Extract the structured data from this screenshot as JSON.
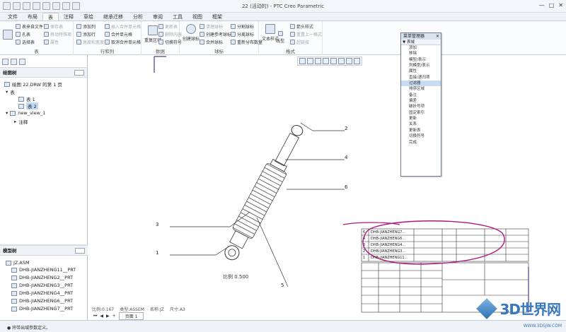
{
  "window": {
    "title": "22 (活动的) - PTC Creo Parametric"
  },
  "tabs": [
    "文件",
    "布局",
    "表",
    "注释",
    "草绘",
    "继承迁移",
    "分析",
    "审阅",
    "工具",
    "视图",
    "框架"
  ],
  "ribbon": {
    "table_group": {
      "items": [
        "表来自文件",
        "孔表",
        "选择表",
        "保存表",
        "移动特殊项",
        "属性"
      ],
      "label": "表"
    },
    "rowcol_group": {
      "items": [
        "添加列",
        "添加行",
        "高度和宽度",
        "插入合并单元格",
        "合并单元格",
        "取消合并单元格"
      ],
      "label": "行和列"
    },
    "data_group": {
      "big_label": "重复区域",
      "label": "数据"
    },
    "balloon_group": {
      "items": [
        "更新表",
        "删除内容",
        "切换符号",
        "创建球标",
        "清理球标",
        "创建参考球标",
        "合并球标",
        "分割球标",
        "分离球标",
        "重新分布数量"
      ],
      "label": "球标"
    },
    "format_group": {
      "items": [
        "文本样式",
        "线型",
        "箭头样式",
        "重置上一格式",
        "超链接"
      ],
      "label": "格式"
    }
  },
  "left_panel": {
    "drawing_tree_title": "绘图树",
    "tree": [
      "绘图 22.DRW 的第 1 页",
      "表",
      "表 1",
      "表 2",
      "new_view_1",
      "注释"
    ],
    "model_tree_title": "模型树",
    "model_items": [
      "JZ.ASM",
      "DHB-JIANZHENG11__PRT",
      "DHB-JIANZHENG2__PRT",
      "DHB-JIANZHENG3__PRT",
      "DHB-JIANZHENG4__PRT",
      "DHB-JIANZHENG6__PRT",
      "DHB-JIANZHENG7__PRT"
    ]
  },
  "menu_manager": {
    "title": "菜单管理器",
    "subtitle": "▼ 表域",
    "items": [
      "添加",
      "移除",
      "模型/表示",
      "列模型/表示",
      "属性",
      "直接/递归项",
      "过滤器",
      "排序区域",
      "备注",
      "偏差",
      "破折号项",
      "固定索引",
      "更新",
      "关系",
      "更新表",
      "切换符号",
      "完成"
    ],
    "active_index": 6
  },
  "drawing": {
    "balloons": [
      "2",
      "4",
      "6",
      "3",
      "1",
      "5"
    ],
    "scale_note": "比例  0.500",
    "bom_rows": [
      {
        "idx": "6",
        "part": "DHB-JIANZHENG7..."
      },
      {
        "idx": "4",
        "part": "DHB-JIANZHENG6..."
      },
      {
        "idx": "3",
        "part": "DHB-JIANZHENG4..."
      },
      {
        "idx": "2",
        "part": "DHB-JIANZHENG3..."
      },
      {
        "idx": "1",
        "part": "DHB-JIANZHENG11..."
      }
    ]
  },
  "status": {
    "scale_items": [
      "比例:0.167",
      "类型:ASSEM",
      "名称:JZ",
      "尺寸:A3"
    ],
    "page_label": "页面 1",
    "message": "● 将带出域参数定义。"
  },
  "watermark": {
    "text": "3D世界网",
    "sub": "WWW.3DSJW.COM"
  },
  "colors": {
    "highlight": "#b0177f",
    "accent": "#2d6fb4"
  }
}
